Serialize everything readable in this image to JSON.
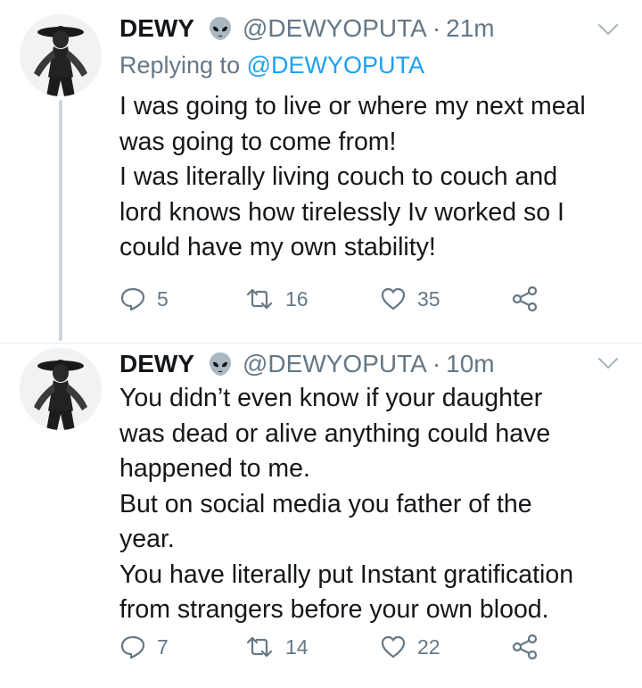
{
  "tweets": [
    {
      "name": "DEWY",
      "handle": "@DEWYOPUTA",
      "separator": "·",
      "time": "21m",
      "replying_prefix": "Replying to ",
      "replying_handle": "@DEWYOPUTA",
      "lines": [
        "I was going to live or where my next meal",
        "was going to come from!",
        "I was literally living couch to couch and",
        "lord knows how tirelessly Iv worked so I",
        "could have my own stability!"
      ],
      "replies": "5",
      "retweets": "16",
      "likes": "35"
    },
    {
      "name": "DEWY",
      "handle": "@DEWYOPUTA",
      "separator": "·",
      "time": "10m",
      "lines": [
        "You didn’t even know if your daughter",
        "was dead or alive anything could have",
        "happened to me.",
        "But on social media you father of the",
        "year.",
        "You have literally put Instant gratification",
        "from strangers before your own blood."
      ],
      "replies": "7",
      "retweets": "14",
      "likes": "22"
    }
  ],
  "icons": {
    "name_badge": "alien-emoji-icon",
    "menu": "chevron-down-icon",
    "reply": "reply-icon",
    "retweet": "retweet-icon",
    "like": "heart-icon",
    "share": "share-icon"
  },
  "colors": {
    "text": "#14171a",
    "muted": "#657786",
    "link": "#1da1f2",
    "thread_line": "#ccd6dd"
  }
}
